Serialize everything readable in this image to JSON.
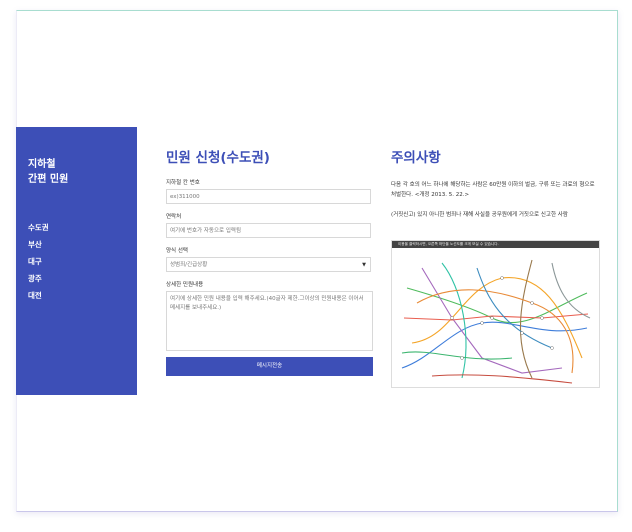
{
  "sidebar": {
    "title_line1": "지하철",
    "title_line2": "간편 민원",
    "nav": [
      "수도권",
      "부산",
      "대구",
      "광주",
      "대전"
    ]
  },
  "form": {
    "heading": "민원 신청(수도권)",
    "car_label": "지하철 칸 번호",
    "car_value": "ex)311000",
    "contact_label": "연락처",
    "contact_placeholder": "여기에 번호가 자동으로 입력됨",
    "type_label": "양식 선택",
    "type_value": "성범죄/긴급상황",
    "detail_label": "상세한 민원내용",
    "detail_placeholder": "여기에 상세한 민원 내용을 입력 해주세요.(40글자 제한.그이상의 민원내용은 이어서 메세지를 보내주세요.)",
    "submit_label": "메시지전송"
  },
  "notice": {
    "heading": "주의사항",
    "text1": "다음 각 호의 어느 하나에 해당하는 사람은 60만원 이하의 벌금, 구류 또는 과료의 형으로 처벌한다. <개정 2013. 5. 22.>",
    "text2": "(거짓신고) 있지 아니한 범죄나 재해 사실을 공무원에게 거짓으로 신고한 사람",
    "map_caption": "이용을 클릭하시면, 오른쪽 하단을 노선도를 크게 보실 수 있습니다."
  },
  "colors": {
    "accent": "#3d4fb7"
  }
}
